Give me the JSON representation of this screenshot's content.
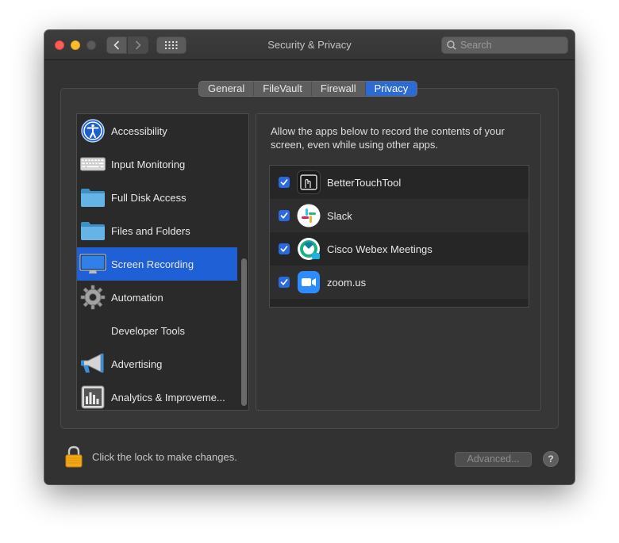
{
  "window": {
    "title": "Security & Privacy"
  },
  "search": {
    "placeholder": "Search"
  },
  "tabs": [
    {
      "label": "General",
      "active": false
    },
    {
      "label": "FileVault",
      "active": false
    },
    {
      "label": "Firewall",
      "active": false
    },
    {
      "label": "Privacy",
      "active": true
    }
  ],
  "sidebar": {
    "items": [
      {
        "label": "Accessibility",
        "icon": "accessibility-icon",
        "selected": false
      },
      {
        "label": "Input Monitoring",
        "icon": "keyboard-icon",
        "selected": false
      },
      {
        "label": "Full Disk Access",
        "icon": "folder-icon",
        "selected": false
      },
      {
        "label": "Files and Folders",
        "icon": "folder-icon",
        "selected": false
      },
      {
        "label": "Screen Recording",
        "icon": "display-icon",
        "selected": true
      },
      {
        "label": "Automation",
        "icon": "gear-icon",
        "selected": false
      },
      {
        "label": "Developer Tools",
        "icon": "",
        "selected": false
      },
      {
        "label": "Advertising",
        "icon": "megaphone-icon",
        "selected": false
      },
      {
        "label": "Analytics & Improveme...",
        "icon": "analytics-icon",
        "selected": false
      }
    ]
  },
  "main": {
    "description": "Allow the apps below to record the contents of your screen, even while using other apps.",
    "apps": [
      {
        "name": "BetterTouchTool",
        "checked": true,
        "icon": "bettertouchtool-icon"
      },
      {
        "name": "Slack",
        "checked": true,
        "icon": "slack-icon"
      },
      {
        "name": "Cisco Webex Meetings",
        "checked": true,
        "icon": "webex-icon"
      },
      {
        "name": "zoom.us",
        "checked": true,
        "icon": "zoom-icon"
      }
    ]
  },
  "footer": {
    "lock_text": "Click the lock to make changes.",
    "advanced_label": "Advanced...",
    "help_label": "?"
  },
  "colors": {
    "accent": "#2c6ad6",
    "window_bg": "#323232",
    "selected_row": "#1f60d6"
  }
}
